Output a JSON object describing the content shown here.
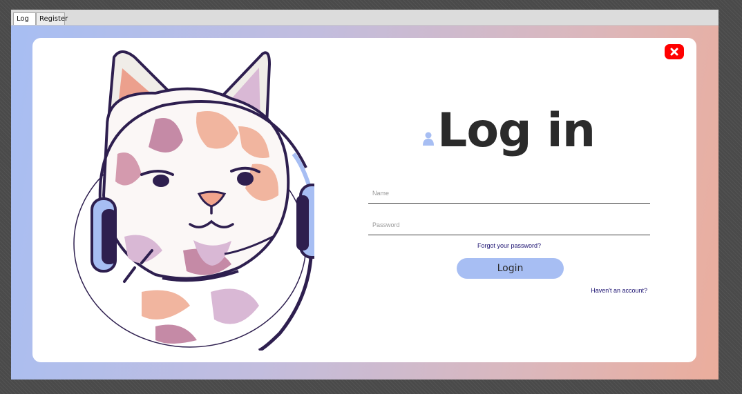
{
  "tabs": [
    {
      "label": "Log in",
      "active": true
    },
    {
      "label": "Register",
      "active": false
    }
  ],
  "login": {
    "title": "Log in",
    "name_placeholder": "Name",
    "name_value": "",
    "password_placeholder": "Password",
    "password_value": "",
    "forgot_link": "Forgot your password?",
    "login_button": "Login",
    "register_link": "Haven't an account?"
  },
  "icons": {
    "close": "close-icon",
    "user": "user-icon",
    "illustration": "cat-headphones-illustration"
  },
  "colors": {
    "accent": "#a7bef3",
    "gradient_start": "#a7bef3",
    "gradient_end": "#ebad9c",
    "close": "#ff0000",
    "link": "#1a1070",
    "title": "#2b2b2b"
  }
}
